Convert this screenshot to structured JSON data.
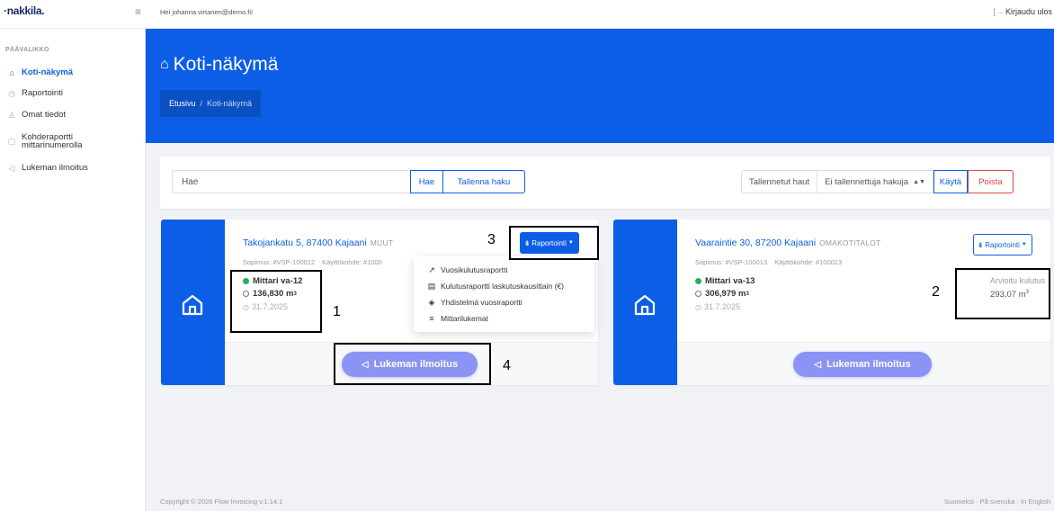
{
  "topbar": {
    "logo": "·nakkila.",
    "greeting": "Hei johanna.virtanen@demo.fi!",
    "logout": "Kirjaudu ulos"
  },
  "sidebar": {
    "heading": "PÄÄVALIKKO",
    "items": [
      {
        "label": "Koti-näkymä",
        "icon": "home-icon",
        "active": true
      },
      {
        "label": "Raportointi",
        "icon": "clock-icon",
        "active": false
      },
      {
        "label": "Omat tiedot",
        "icon": "user-icon",
        "active": false
      },
      {
        "label": "Kohderaportti mittarinumerolla",
        "icon": "document-icon",
        "active": false
      },
      {
        "label": "Lukeman ilmoitus",
        "icon": "send-icon",
        "active": false
      }
    ]
  },
  "hero": {
    "title": "Koti-näkymä",
    "breadcrumb": {
      "home": "Etusivu",
      "separator": "/",
      "current": "Koti-näkymä"
    }
  },
  "search": {
    "placeholder": "Hae",
    "search_button": "Hae",
    "save_button": "Tallenna haku",
    "saved_label": "Tallennetut haut",
    "saved_select": "Ei tallennettuja hakuja",
    "apply_button": "Käytä",
    "delete_button": "Poista"
  },
  "properties": [
    {
      "address": "Takojankatu 5, 87400 Kajaani",
      "type": "MUUT",
      "contract": "Sopimus: #VSP-100012",
      "site": "Käyttökohde: #1000",
      "meter": "Mittari va-12",
      "reading": "136,830 m",
      "unit_sup": "3",
      "date": "31.7.2025",
      "report_button": "Raportointi",
      "read_button": "Lukeman ilmoitus"
    },
    {
      "address": "Vaaraintie 30, 87200 Kajaani",
      "type": "OMAKOTITALOT",
      "contract": "Sopimus: #VSP-100013",
      "site": "Käyttökohde: #100013",
      "meter": "Mittari va-13",
      "reading": "306,979 m",
      "unit_sup": "3",
      "date": "31.7.2025",
      "report_button": "Raportointi",
      "estimate_label": "Arvioitu kulutus",
      "estimate_value": "293,07 m",
      "read_button": "Lukeman ilmoitus"
    }
  ],
  "dropdown": {
    "items": [
      {
        "label": "Vuosikulutusraportti",
        "icon": "trend-icon"
      },
      {
        "label": "Kulutusraportti laskutuskausittain (€)",
        "icon": "file-icon"
      },
      {
        "label": "Yhdistelmä vuosiraportti",
        "icon": "layers-icon"
      },
      {
        "label": "Mittarilukemat",
        "icon": "list-icon"
      }
    ]
  },
  "annotations": [
    "1",
    "2",
    "3",
    "4"
  ],
  "footer": {
    "copyright": "Copyright © 2026 Flow Invoicing v.1.14.1",
    "languages": "Suomeksi · På svenska · In English"
  },
  "colors": {
    "primary": "#0d5ee6",
    "danger": "#e04848",
    "accent_button": "#8b93f5",
    "status_ok": "#27ae60"
  }
}
